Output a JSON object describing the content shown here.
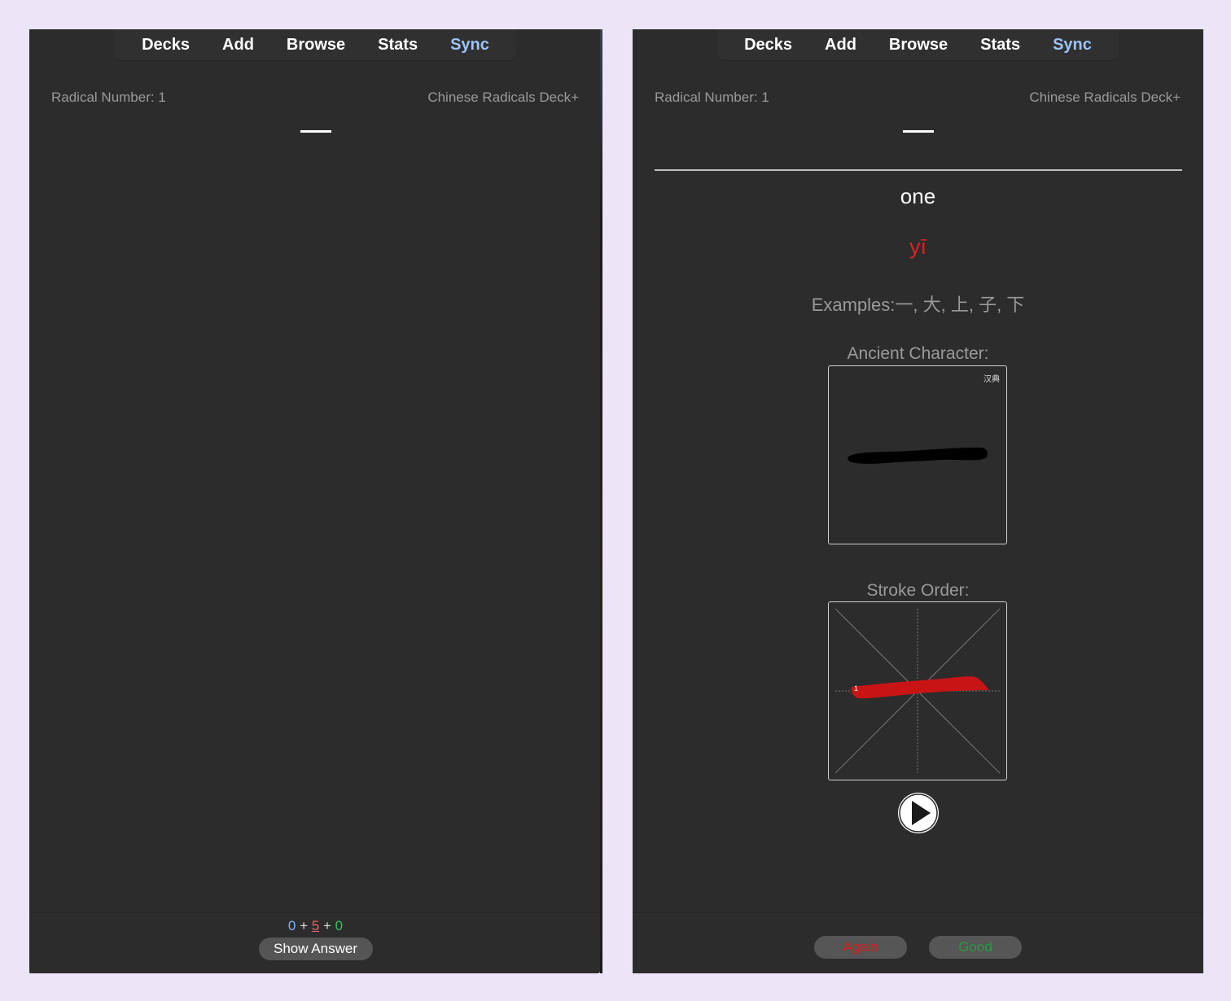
{
  "toolbar": {
    "items": [
      "Decks",
      "Add",
      "Browse",
      "Stats",
      "Sync"
    ],
    "active_accent_color": "#9dc3f7"
  },
  "front_window": {
    "header": {
      "left": "Radical Number: 1",
      "right": "Chinese Radicals Deck+"
    },
    "radical": "一",
    "counts": {
      "new": "0",
      "plus": "+",
      "learning": "5",
      "review": "0"
    },
    "show_answer_label": "Show Answer"
  },
  "back_window": {
    "header": {
      "left": "Radical Number: 1",
      "right": "Chinese Radicals Deck+"
    },
    "radical": "一",
    "meaning": "one",
    "pinyin": "yī",
    "examples": "Examples:一, 大, 上, 子, 下",
    "ancient_label": "Ancient Character:",
    "ancient_source_mark": "汉典",
    "stroke_order_label": "Stroke Order:",
    "stroke_number": "1",
    "play_icon": "play-icon",
    "again_label": "Again",
    "good_label": "Good"
  },
  "colors": {
    "background": "#ece4f7",
    "window": "#2c2c2c",
    "pinyin": "#e02020",
    "stroke": "#c81414",
    "again": "#d81d1d",
    "good": "#2a9a3c",
    "new_count": "#80b3ff",
    "learning_count": "#e06666",
    "review_count": "#3cbf58"
  }
}
